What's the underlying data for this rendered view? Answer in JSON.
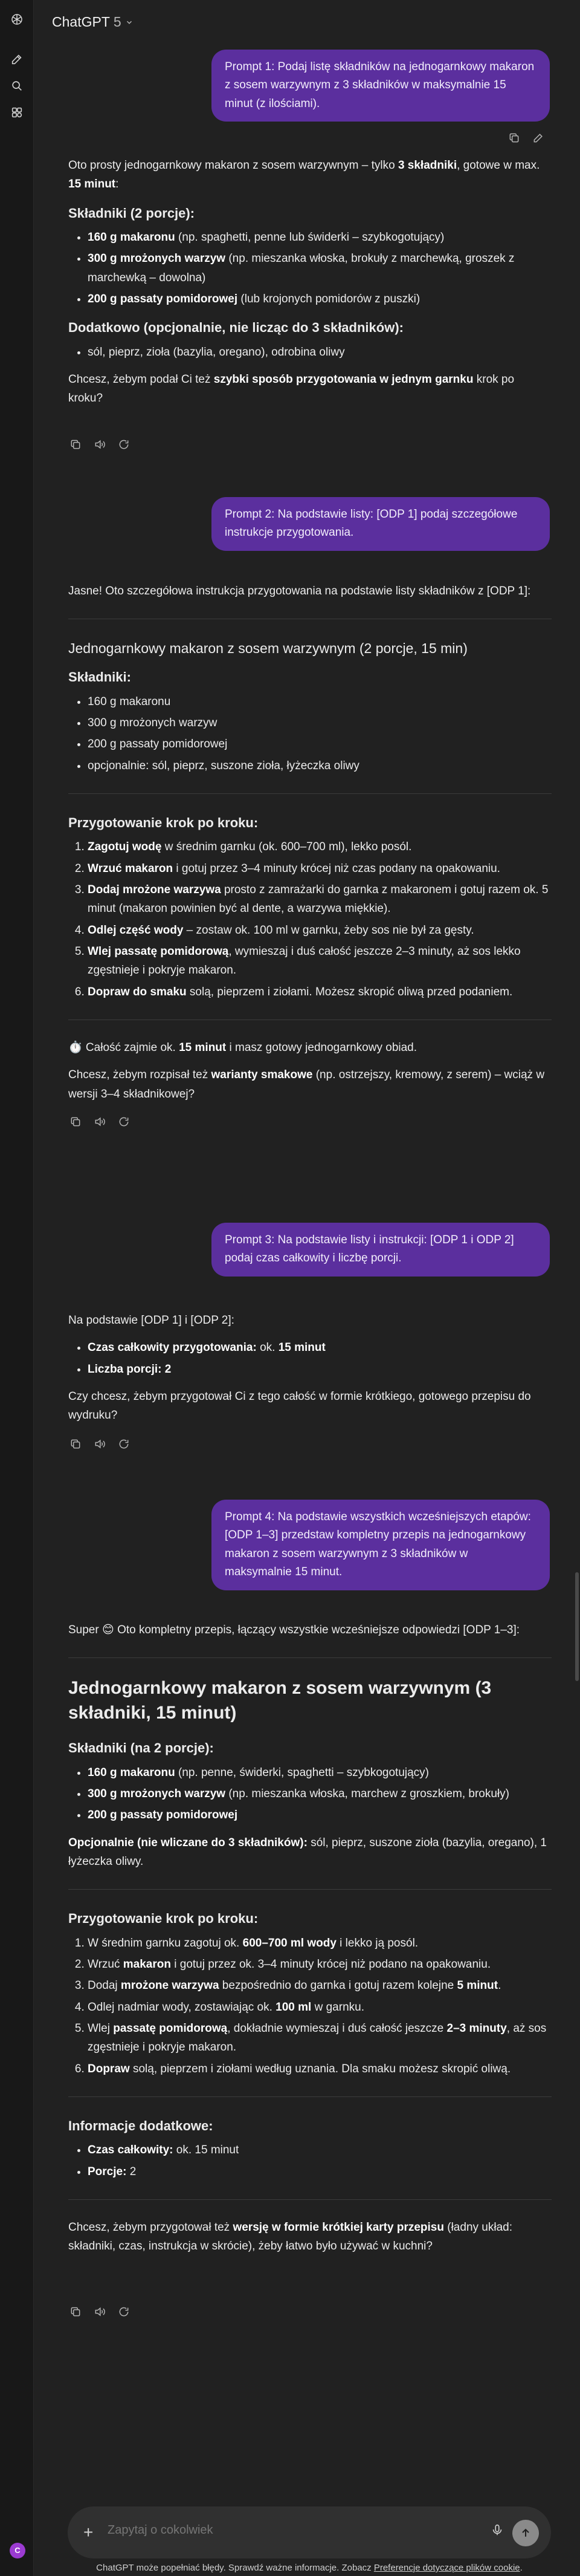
{
  "app": {
    "model": "ChatGPT",
    "version": "5"
  },
  "sidebar": {
    "icons": [
      "openai-logo-icon",
      "new-chat-icon",
      "search-icon",
      "library-icon"
    ],
    "avatar": "C"
  },
  "messages": {
    "p1": "Prompt 1: Podaj listę składników na jednogarnkowy makaron z sosem warzywnym z 3 składników w maksymalnie 15 minut (z ilościami).",
    "a1": {
      "intro_a": "Oto prosty jednogarnkowy makaron z sosem warzywnym – tylko ",
      "intro_b": "3 składniki",
      "intro_c": ", gotowe w max. ",
      "intro_d": "15 minut",
      "intro_e": ":",
      "h_ingr": "Składniki (2 porcje):",
      "i1b": "160 g makaronu",
      "i1t": " (np. spaghetti, penne lub świderki – szybkogotujący)",
      "i2b": "300 g mrożonych warzyw",
      "i2t": " (np. mieszanka włoska, brokuły z marchewką, groszek z marchewką – dowolna)",
      "i3b": "200 g passaty pomidorowej",
      "i3t": " (lub krojonych pomidorów z puszki)",
      "h_extra": "Dodatkowo (opcjonalnie, nie licząc do 3 składników):",
      "e1": "sól, pieprz, zioła (bazylia, oregano), odrobina oliwy",
      "q_a": "Chcesz, żebym podał Ci też ",
      "q_b": "szybki sposób przygotowania w jednym garnku",
      "q_c": " krok po kroku?"
    },
    "p2": "Prompt 2: Na podstawie listy: [ODP 1] podaj szczegółowe instrukcje przygotowania.",
    "a2": {
      "intro": "Jasne! Oto szczegółowa instrukcja przygotowania na podstawie listy składników z [ODP 1]:",
      "title": "Jednogarnkowy makaron z sosem warzywnym (2 porcje, 15 min)",
      "h_ingr": "Składniki:",
      "ingr": [
        "160 g makaronu",
        "300 g mrożonych warzyw",
        "200 g passaty pomidorowej",
        "opcjonalnie: sól, pieprz, suszone zioła, łyżeczka oliwy"
      ],
      "h_steps": "Przygotowanie krok po kroku:",
      "s1b": "Zagotuj wodę",
      "s1t": " w średnim garnku (ok. 600–700 ml), lekko posól.",
      "s2b": "Wrzuć makaron",
      "s2t": " i gotuj przez 3–4 minuty krócej niż czas podany na opakowaniu.",
      "s3b": "Dodaj mrożone warzywa",
      "s3t": " prosto z zamrażarki do garnka z makaronem i gotuj razem ok. 5 minut (makaron powinien być al dente, a warzywa miękkie).",
      "s4b": "Odlej część wody",
      "s4t": " – zostaw ok. 100 ml w garnku, żeby sos nie był za gęsty.",
      "s5b": "Wlej passatę pomidorową",
      "s5t": ", wymieszaj i duś całość jeszcze 2–3 minuty, aż sos lekko zgęstnieje i pokryje makaron.",
      "s6b": "Dopraw do smaku",
      "s6t": " solą, pieprzem i ziołami. Możesz skropić oliwą przed podaniem.",
      "time_a": "⏱️ Całość zajmie ok. ",
      "time_b": "15 minut",
      "time_c": " i masz gotowy jednogarnkowy obiad.",
      "q_a": "Chcesz, żebym rozpisał też ",
      "q_b": "warianty smakowe",
      "q_c": " (np. ostrzejszy, kremowy, z serem) – wciąż w wersji 3–4 składnikowej?"
    },
    "p3": "Prompt 3: Na podstawie listy i instrukcji: [ODP 1 i ODP 2] podaj czas całkowity i liczbę porcji.",
    "a3": {
      "intro": "Na podstawie [ODP 1] i [ODP 2]:",
      "l1b": "Czas całkowity przygotowania:",
      "l1t": " ok. ",
      "l1v": "15 minut",
      "l2b": "Liczba porcji: 2",
      "q": "Czy chcesz, żebym przygotował Ci z tego całość w formie krótkiego, gotowego przepisu do wydruku?"
    },
    "p4": "Prompt 4: Na podstawie wszystkich wcześniejszych etapów: [ODP 1–3] przedstaw kompletny przepis na jednogarnkowy makaron z sosem warzywnym z 3 składników w maksymalnie 15 minut.",
    "a4": {
      "intro": "Super 😊 Oto kompletny przepis, łączący wszystkie wcześniejsze odpowiedzi [ODP 1–3]:",
      "title": "Jednogarnkowy makaron z sosem warzywnym (3 składniki, 15 minut)",
      "h_ingr": "Składniki (na 2 porcje):",
      "i1b": "160 g makaronu",
      "i1t": " (np. penne, świderki, spaghetti – szybkogotujący)",
      "i2b": "300 g mrożonych warzyw",
      "i2t": " (np. mieszanka włoska, marchew z groszkiem, brokuły)",
      "i3b": "200 g passaty pomidorowej",
      "opt_b": "Opcjonalnie (nie wliczane do 3 składników):",
      "opt_t": " sól, pieprz, suszone zioła (bazylia, oregano), 1 łyżeczka oliwy.",
      "h_steps": "Przygotowanie krok po kroku:",
      "s1a": "W średnim garnku zagotuj ok. ",
      "s1b": "600–700 ml wody",
      "s1c": " i lekko ją posól.",
      "s2a": "Wrzuć ",
      "s2b": "makaron",
      "s2c": " i gotuj przez ok. 3–4 minuty krócej niż podano na opakowaniu.",
      "s3a": "Dodaj ",
      "s3b": "mrożone warzywa",
      "s3c": " bezpośrednio do garnka i gotuj razem kolejne ",
      "s3d": "5 minut",
      "s3e": ".",
      "s4a": "Odlej nadmiar wody, zostawiając ok. ",
      "s4b": "100 ml",
      "s4c": " w garnku.",
      "s5a": "Wlej ",
      "s5b": "passatę pomidorową",
      "s5c": ", dokładnie wymieszaj i duś całość jeszcze ",
      "s5d": "2–3 minuty",
      "s5e": ", aż sos zgęstnieje i pokryje makaron.",
      "s6a": "Dopraw",
      "s6b": " solą, pieprzem i ziołami według uznania. Dla smaku możesz skropić oliwą.",
      "h_info": "Informacje dodatkowe:",
      "inf1b": "Czas całkowity:",
      "inf1t": " ok. 15 minut",
      "inf2b": "Porcje:",
      "inf2t": " 2",
      "q_a": "Chcesz, żebym przygotował też ",
      "q_b": "wersję w formie krótkiej karty przepisu",
      "q_c": " (ładny układ: składniki, czas, instrukcja w skrócie), żeby łatwo było używać w kuchni?"
    }
  },
  "composer": {
    "placeholder": "Zapytaj o cokolwiek"
  },
  "footer": {
    "text": "ChatGPT może popełniać błędy. Sprawdź ważne informacje. Zobacz ",
    "link": "Preferencje dotyczące plików cookie",
    "end": "."
  }
}
